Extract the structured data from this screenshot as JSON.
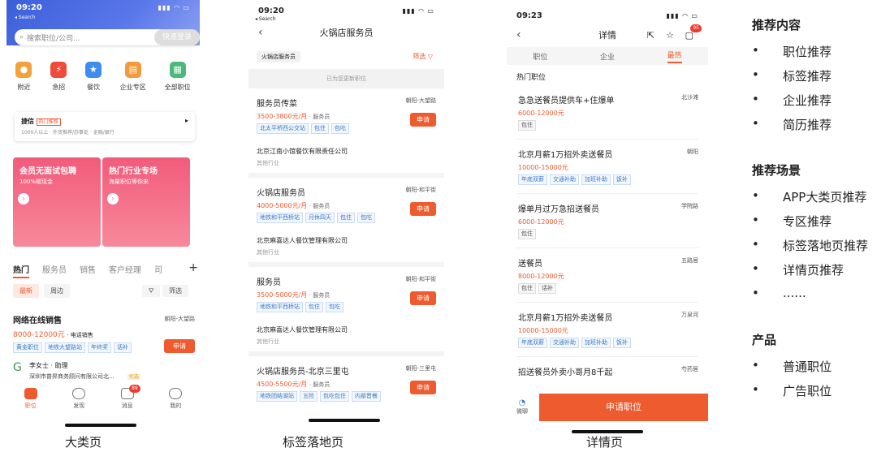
{
  "phone1": {
    "time": "09:20",
    "search_back": "◂ Search",
    "search_placeholder": "搜索职位/公司...",
    "login_label": "快速登录",
    "categories": [
      {
        "label": "附近",
        "color": "#f4a13a",
        "icon": "location-icon"
      },
      {
        "label": "急招",
        "color": "#ee4b3b",
        "icon": "urgent-icon"
      },
      {
        "label": "餐饮",
        "color": "#3d8cf0",
        "icon": "restaurant-icon"
      },
      {
        "label": "企业专区",
        "color": "#f39a3d",
        "icon": "company-icon"
      },
      {
        "label": "全部职位",
        "color": "#4cb87a",
        "icon": "grid-icon"
      }
    ],
    "jiepin_title": "捷信",
    "jiepin_badge": "热门推荐",
    "jiepin_desc": "1000人以上 · 外贸推荐/办事处 · 金融/银行",
    "banner1_title": "会员无面试包聘",
    "banner1_sub": "100%赠现金",
    "banner2_title": "热门行业专场",
    "banner2_sub": "海量职位等你来",
    "tabs": [
      "热门",
      "服务员",
      "销售",
      "客户经理",
      "司"
    ],
    "filters": [
      "最新",
      "周边"
    ],
    "filter_label": "筛选",
    "job": {
      "title": "网络在线销售",
      "location": "朝阳-大望路",
      "salary": "8000-12000元",
      "role": "· 电话销售",
      "tags": [
        "黄金职位",
        "地铁大望路站",
        "年终奖",
        "话补"
      ],
      "apply": "申请",
      "contact": "李女士 · 助理",
      "company": "深圳市普昇商务顾问有限公司北...",
      "badge": "优选"
    },
    "tabbar": [
      {
        "label": "职位",
        "on": true
      },
      {
        "label": "发现"
      },
      {
        "label": "消息"
      },
      {
        "label": "我的"
      }
    ],
    "msg_count": "89",
    "caption": "大类页"
  },
  "phone2": {
    "time": "09:20",
    "search_back": "◂ Search",
    "title": "火锅店服务员",
    "chip": "火锅店服务员",
    "filter": "筛选",
    "rec": "已为您更新职位",
    "jobs": [
      {
        "title": "服务员传菜",
        "location": "朝阳-大望路",
        "salary": "3500-3800元/月",
        "role": "· 服务员",
        "tags": [
          "北太平桥西公交站",
          "包住",
          "包吃"
        ],
        "company": "北京江南小馆餐饮有限责任公司",
        "industry": "其他行业",
        "apply": "申请"
      },
      {
        "title": "火锅店服务员",
        "location": "朝阳-和平街",
        "salary": "4000-5000元/月",
        "role": "· 服务员",
        "tags": [
          "地铁和平西桥站",
          "月休四天",
          "包住",
          "包吃"
        ],
        "company": "北京麻喜达人餐饮管理有限公司",
        "industry": "其他行业",
        "apply": "申请"
      },
      {
        "title": "服务员",
        "location": "朝阳-和平街",
        "salary": "3500-5000元/月",
        "role": "· 服务员",
        "tags": [
          "地铁和平西桥站",
          "包住",
          "包吃"
        ],
        "company": "北京麻喜达人餐饮管理有限公司",
        "industry": "其他行业",
        "apply": "申请"
      },
      {
        "title": "火锅店服务员-北京三里屯",
        "location": "朝阳-三里屯",
        "salary": "4500-5500元/月",
        "role": "· 服务员",
        "tags": [
          "地铁团结湖站",
          "五险",
          "包吃包住",
          "内部晋餐"
        ],
        "company": "",
        "industry": "",
        "apply": "申请"
      }
    ],
    "caption": "标签落地页"
  },
  "phone3": {
    "time": "09:23",
    "title": "详情",
    "badge": "95",
    "tabs": [
      "职位",
      "企业",
      "最热"
    ],
    "hot_label": "热门职位",
    "jobs": [
      {
        "title": "急急送餐员提供车+住爆单",
        "location": "北沙滩",
        "salary": "6000-12000元",
        "tags": [
          "包住"
        ]
      },
      {
        "title": "北京月薪1万招外卖送餐员",
        "location": "朝阳",
        "salary": "10000-15000元",
        "tags": [
          "年底双薪",
          "交通补助",
          "加班补助",
          "饭补"
        ]
      },
      {
        "title": "爆单月过万急招送餐员",
        "location": "学院路",
        "salary": "6000-12000元",
        "tags": [
          "包住"
        ]
      },
      {
        "title": "送餐员",
        "location": "五路居",
        "salary": "8000-12000元",
        "tags": [
          "包住",
          "话补"
        ]
      },
      {
        "title": "北京月薪1万招外卖送餐员",
        "location": "万泉河",
        "salary": "10000-15000元",
        "tags": [
          "年底双薪",
          "交通补助",
          "加班补助",
          "饭补"
        ]
      },
      {
        "title": "招送餐员外卖小哥月8千起",
        "location": "芍药居",
        "salary": "",
        "tags": []
      }
    ],
    "wl_label": "微聊",
    "apply_label": "申请职位",
    "caption": "详情页"
  },
  "side": {
    "h1": "推荐内容",
    "list1": [
      "职位推荐",
      "标签推荐",
      "企业推荐",
      "简历推荐"
    ],
    "h2": "推荐场景",
    "list2": [
      "APP大类页推荐",
      "专区推荐",
      "标签落地页推荐",
      "详情页推荐",
      "......"
    ],
    "h3": "产品",
    "list3": [
      "普通职位",
      "广告职位"
    ]
  }
}
